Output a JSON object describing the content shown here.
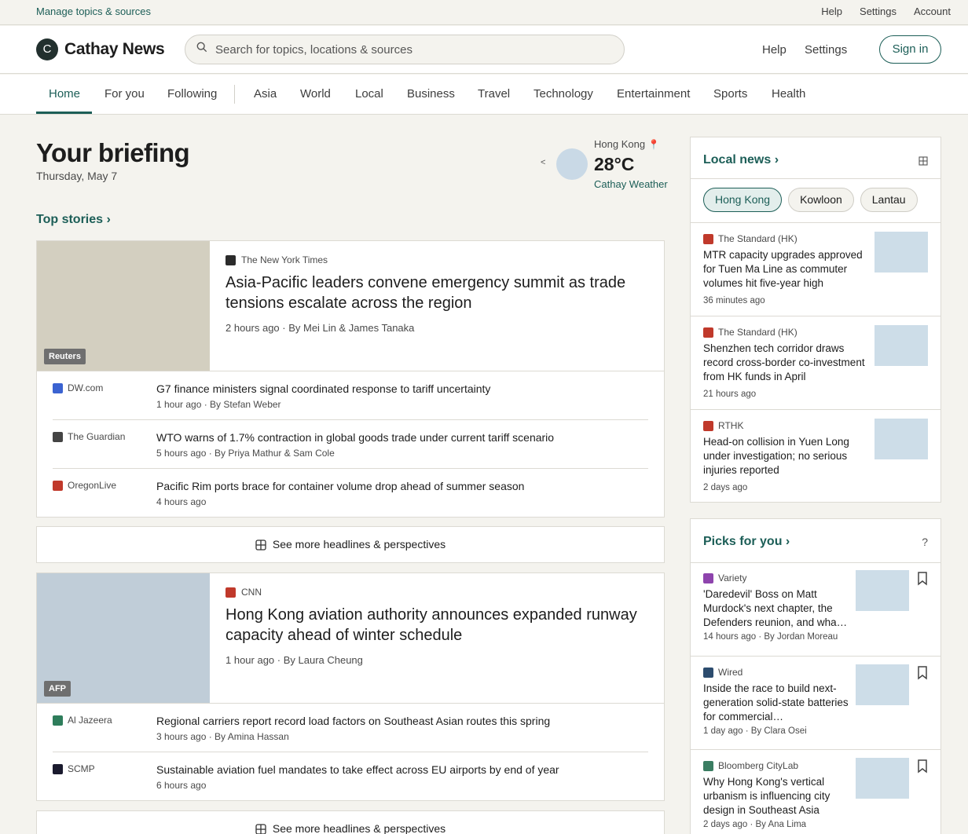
{
  "utilbar": {
    "manage": "Manage topics & sources",
    "help": "Help",
    "settings": "Settings",
    "account": "Account"
  },
  "header": {
    "logo_letter": "C",
    "logo_text": "Cathay News",
    "search_placeholder": "Search for topics, locations & sources",
    "help": "Help",
    "settings": "Settings",
    "signin": "Sign in"
  },
  "nav": {
    "tabs": [
      "Home",
      "For you",
      "Following",
      "Asia",
      "World",
      "Local",
      "Business",
      "Travel",
      "Technology",
      "Entertainment",
      "Sports",
      "Health"
    ],
    "active": "Home"
  },
  "briefing": {
    "title": "Your briefing",
    "date": "Thursday, May 7"
  },
  "weather": {
    "arrow": "<",
    "location": "Hong Kong",
    "temp": "28°C",
    "source": "Cathay Weather"
  },
  "top_stories_label": "Top stories ›",
  "stories": [
    {
      "image_badge": "Reuters",
      "source": "The New York Times",
      "title": "Asia-Pacific leaders convene emergency summit as trade tensions escalate across the region",
      "meta": "2 hours ago · By Mei Lin & James Tanaka",
      "related": [
        {
          "source": "DW.com",
          "title": "G7 finance ministers signal coordinated response to tariff uncertainty",
          "meta": "1 hour ago · By Stefan Weber"
        },
        {
          "source": "The Guardian",
          "title": "WTO warns of 1.7% contraction in global goods trade under current tariff scenario",
          "meta": "5 hours ago · By Priya Mathur & Sam Cole"
        },
        {
          "source": "OregonLive",
          "title": "Pacific Rim ports brace for container volume drop ahead of summer season",
          "meta": "4 hours ago"
        }
      ]
    },
    {
      "image_badge": "AFP",
      "source": "CNN",
      "title": "Hong Kong aviation authority announces expanded runway capacity ahead of winter schedule",
      "meta": "1 hour ago · By Laura Cheung",
      "related": [
        {
          "source": "Al Jazeera",
          "title": "Regional carriers report record load factors on Southeast Asian routes this spring",
          "meta": "3 hours ago · By Amina Hassan"
        },
        {
          "source": "SCMP",
          "title": "Sustainable aviation fuel mandates to take effect across EU airports by end of year",
          "meta": "6 hours ago"
        }
      ]
    }
  ],
  "see_more": "See more headlines & perspectives",
  "local_news": {
    "title": "Local news ›",
    "chips": [
      "Hong Kong",
      "Kowloon",
      "Lantau"
    ],
    "active_chip": "Hong Kong",
    "items": [
      {
        "source": "The Standard (HK)",
        "title": "MTR capacity upgrades approved for Tuen Ma Line as commuter volumes hit five-year high",
        "meta": "36 minutes ago"
      },
      {
        "source": "The Standard (HK)",
        "title": "Shenzhen tech corridor draws record cross-border co-investment from HK funds in April",
        "meta": "21 hours ago"
      },
      {
        "source": "RTHK",
        "title": "Head-on collision in Yuen Long under investigation; no serious injuries reported",
        "meta": "2 days ago"
      }
    ]
  },
  "picks": {
    "title": "Picks for you ›",
    "help_icon": "?",
    "items": [
      {
        "source": "Variety",
        "title": "'Daredevil' Boss on Matt Murdock's next chapter, the Defenders reunion, and wha…",
        "meta": "14 hours ago · By Jordan Moreau"
      },
      {
        "source": "Wired",
        "title": "Inside the race to build next-generation solid-state batteries for commercial…",
        "meta": "1 day ago · By Clara Osei"
      },
      {
        "source": "Bloomberg CityLab",
        "title": "Why Hong Kong's vertical urbanism is influencing city design in Southeast Asia",
        "meta": "2 days ago · By Ana Lima"
      }
    ]
  },
  "colors": {
    "accent": "#1c5e57",
    "favicon_nyt": "#2b2b2b",
    "favicon_dw": "#3b63d1",
    "favicon_guardian": "#444444",
    "favicon_oregon": "#c0392b",
    "favicon_cnn": "#c0392b",
    "favicon_aljazeera": "#2e7d5b",
    "favicon_scmp": "#1a1a2e",
    "favicon_standard": "#c0392b",
    "favicon_rthk": "#c0392b",
    "favicon_variety": "#8e44ad",
    "favicon_wired": "#2c4c6e",
    "favicon_citylab": "#3a7d62"
  },
  "icons": {
    "search": "search-icon",
    "pin": "location-pin-icon",
    "grid": "grid-icon",
    "bookmark": "bookmark-icon"
  }
}
